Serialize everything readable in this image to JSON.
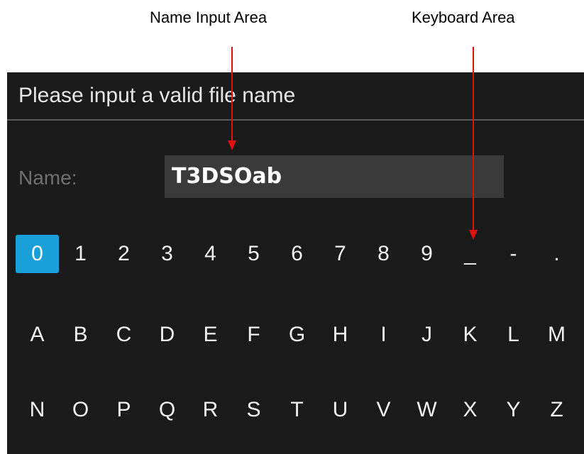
{
  "annotations": {
    "name_input_area": "Name Input Area",
    "keyboard_area": "Keyboard Area"
  },
  "dialog": {
    "title": "Please input a valid file name",
    "name_label": "Name:",
    "name_value": "T3DSOab"
  },
  "keyboard": {
    "rows": [
      [
        "0",
        "1",
        "2",
        "3",
        "4",
        "5",
        "6",
        "7",
        "8",
        "9",
        "_",
        "-",
        "."
      ],
      [
        "A",
        "B",
        "C",
        "D",
        "E",
        "F",
        "G",
        "H",
        "I",
        "J",
        "K",
        "L",
        "M"
      ],
      [
        "N",
        "O",
        "P",
        "Q",
        "R",
        "S",
        "T",
        "U",
        "V",
        "W",
        "X",
        "Y",
        "Z"
      ]
    ],
    "selected_key": "0"
  },
  "colors": {
    "screen_bg": "#1a1a1a",
    "input_bg": "#3a3a3a",
    "selected_key_bg": "#1aa0d8",
    "arrow": "#e01010"
  }
}
